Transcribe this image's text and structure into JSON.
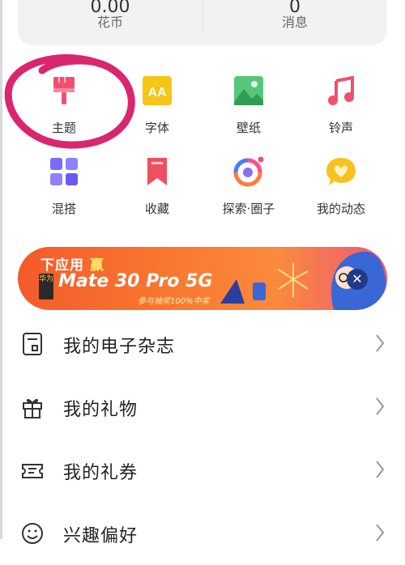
{
  "stats": [
    {
      "value": "0.00",
      "label": "花币"
    },
    {
      "value": "0",
      "label": "消息"
    }
  ],
  "grid": [
    {
      "label": "主题",
      "icon": "paint-brush-icon"
    },
    {
      "label": "字体",
      "icon": "font-icon"
    },
    {
      "label": "壁纸",
      "icon": "wallpaper-icon"
    },
    {
      "label": "铃声",
      "icon": "music-note-icon"
    },
    {
      "label": "混搭",
      "icon": "mix-grid-icon"
    },
    {
      "label": "收藏",
      "icon": "bookmark-icon"
    },
    {
      "label": "探索·圈子",
      "icon": "explore-circle-icon"
    },
    {
      "label": "我的动态",
      "icon": "heart-bubble-icon"
    }
  ],
  "banner": {
    "line1_prefix": "下应用",
    "line1_win": "赢",
    "brand": "华为",
    "main": "Mate 30 Pro 5G",
    "sub": "参与抽奖100%中奖",
    "close_icon": "close-icon"
  },
  "list": [
    {
      "label": "我的电子杂志",
      "icon": "magazine-icon"
    },
    {
      "label": "我的礼物",
      "icon": "gift-icon"
    },
    {
      "label": "我的礼券",
      "icon": "coupon-icon"
    },
    {
      "label": "兴趣偏好",
      "icon": "smile-icon"
    }
  ],
  "colors": {
    "accent_theme": "#f0506e",
    "font_icon": "#f5c518",
    "wallpaper": "#3fb765",
    "ringtone": "#f0506e",
    "mix": "#7b6cf6",
    "bookmark": "#f04f5f",
    "heart_bubble": "#f7c21d",
    "annotation": "#d9266f"
  }
}
